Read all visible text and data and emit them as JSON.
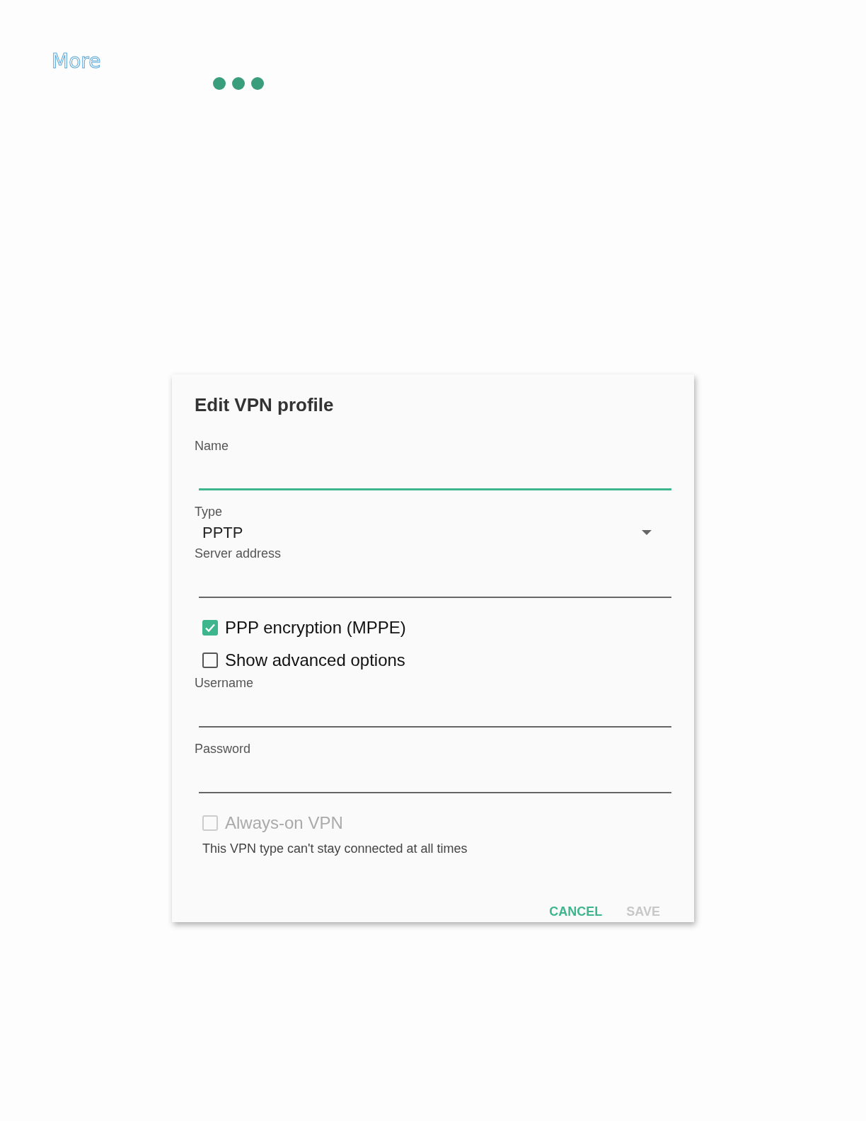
{
  "header": {
    "title": "More"
  },
  "dialog": {
    "title": "Edit VPN profile",
    "items": [
      {
        "kind": "text_field",
        "label": "Name",
        "focused": true
      },
      {
        "kind": "dropdown",
        "label": "Type",
        "value": "PPTP"
      },
      {
        "kind": "text_field",
        "label": "Server address",
        "focused": false
      },
      {
        "kind": "checkbox",
        "label": "PPP encryption (MPPE)",
        "checked": true,
        "disabled": false
      },
      {
        "kind": "checkbox",
        "label": "Show advanced options",
        "checked": false,
        "disabled": false
      },
      {
        "kind": "text_field",
        "label": "Username",
        "focused": false
      },
      {
        "kind": "text_field",
        "label": "Password",
        "focused": false
      },
      {
        "kind": "checkbox",
        "label": "Always-on VPN",
        "checked": false,
        "disabled": true
      },
      {
        "kind": "helper",
        "text": "This VPN type can't stay connected at all times"
      }
    ],
    "buttons": [
      {
        "label": "CANCEL",
        "disabled": false
      },
      {
        "label": "SAVE",
        "disabled": true
      }
    ]
  }
}
